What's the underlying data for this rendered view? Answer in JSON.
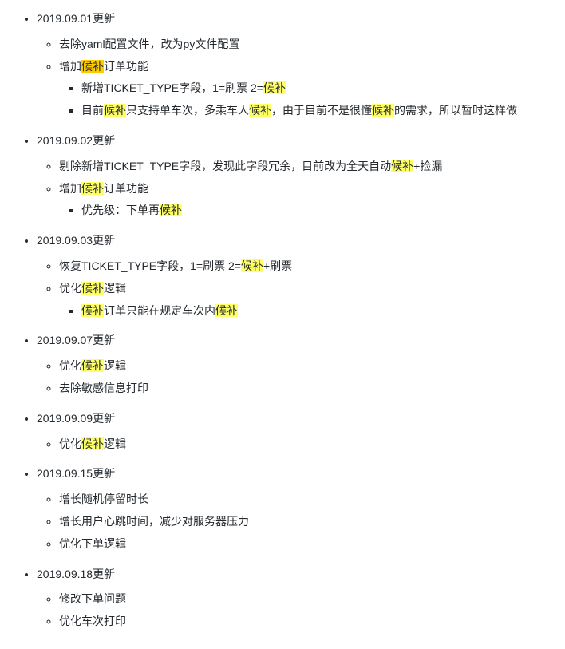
{
  "highlight_term": "候补",
  "updates": [
    {
      "date": "2019.09.01更新",
      "items": [
        {
          "text": "去除yaml配置文件，改为py文件配置"
        },
        {
          "text": "增加候补订单功能",
          "hl_first_orange": true,
          "sub": [
            {
              "text": "新增TICKET_TYPE字段，1=刷票 2=候补"
            },
            {
              "text": "目前候补只支持单车次，多乘车人候补，由于目前不是很懂候补的需求，所以暂时这样做"
            }
          ]
        }
      ]
    },
    {
      "date": "2019.09.02更新",
      "items": [
        {
          "text": "剔除新增TICKET_TYPE字段，发现此字段冗余，目前改为全天自动候补+捡漏"
        },
        {
          "text": "增加候补订单功能",
          "sub": [
            {
              "text": "优先级：下单再候补"
            }
          ]
        }
      ]
    },
    {
      "date": "2019.09.03更新",
      "items": [
        {
          "text": "恢复TICKET_TYPE字段，1=刷票 2=候补+刷票"
        },
        {
          "text": "优化候补逻辑",
          "sub": [
            {
              "text": "候补订单只能在规定车次内候补"
            }
          ]
        }
      ]
    },
    {
      "date": "2019.09.07更新",
      "items": [
        {
          "text": "优化候补逻辑"
        },
        {
          "text": "去除敏感信息打印"
        }
      ]
    },
    {
      "date": "2019.09.09更新",
      "items": [
        {
          "text": "优化候补逻辑"
        }
      ]
    },
    {
      "date": "2019.09.15更新",
      "items": [
        {
          "text": "增长随机停留时长"
        },
        {
          "text": "增长用户心跳时间，减少对服务器压力"
        },
        {
          "text": "优化下单逻辑"
        }
      ]
    },
    {
      "date": "2019.09.18更新",
      "items": [
        {
          "text": "修改下单问题"
        },
        {
          "text": "优化车次打印"
        }
      ]
    }
  ]
}
